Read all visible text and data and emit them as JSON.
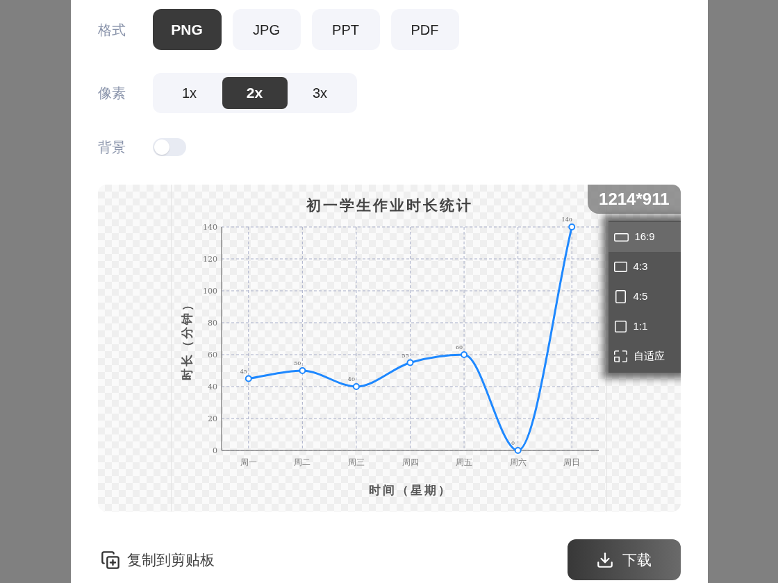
{
  "format": {
    "label": "格式",
    "options": [
      {
        "label": "PNG",
        "selected": true
      },
      {
        "label": "JPG",
        "selected": false
      },
      {
        "label": "PPT",
        "selected": false
      },
      {
        "label": "PDF",
        "selected": false
      }
    ]
  },
  "resolution": {
    "label": "像素",
    "options": [
      {
        "label": "1x",
        "selected": false
      },
      {
        "label": "2x",
        "selected": true
      },
      {
        "label": "3x",
        "selected": false
      }
    ]
  },
  "background": {
    "label": "背景",
    "on": false
  },
  "preview": {
    "size_badge": "1214*911",
    "ratio_menu": [
      {
        "label": "16:9",
        "kind": "wide",
        "selected": true
      },
      {
        "label": "4:3",
        "kind": "landscape",
        "selected": false
      },
      {
        "label": "4:5",
        "kind": "portrait",
        "selected": false
      },
      {
        "label": "1:1",
        "kind": "square",
        "selected": false
      },
      {
        "label": "自适应",
        "kind": "fit",
        "selected": false
      }
    ],
    "chart_data": {
      "type": "line",
      "title": "初一学生作业时长统计",
      "xlabel": "时间（星期）",
      "ylabel": "时长（分钟）",
      "categories": [
        "周一",
        "周二",
        "周三",
        "周四",
        "周五",
        "周六",
        "周日"
      ],
      "series": [
        {
          "color": "#1e88ff",
          "marker": "circle",
          "values": [
            45,
            50,
            40,
            55,
            60,
            0,
            140
          ]
        }
      ],
      "ylim": [
        0,
        140
      ],
      "yticks": [
        0,
        20,
        40,
        60,
        80,
        100,
        120,
        140
      ],
      "grid": true,
      "data_labels": true
    }
  },
  "actions": {
    "copy_label": "复制到剪贴板",
    "download_label": "下载"
  }
}
